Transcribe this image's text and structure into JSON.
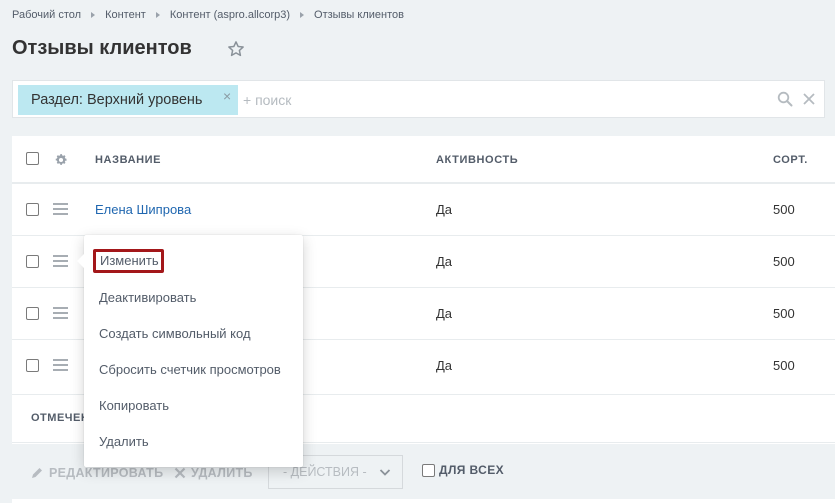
{
  "breadcrumbs": [
    "Рабочий стол",
    "Контент",
    "Контент (aspro.allcorp3)",
    "Отзывы клиентов"
  ],
  "page": {
    "title": "Отзывы клиентов"
  },
  "filter": {
    "chip_label": "Раздел: Верхний уровень",
    "chip_close": "×",
    "search_placeholder": "+ поиск"
  },
  "grid": {
    "columns": {
      "name": "НАЗВАНИЕ",
      "active": "АКТИВНОСТЬ",
      "sort": "СОРТ."
    },
    "rows": [
      {
        "name": "Елена Шипрова",
        "active": "Да",
        "sort": "500"
      },
      {
        "name": "",
        "active": "Да",
        "sort": "500"
      },
      {
        "name": "",
        "active": "Да",
        "sort": "500"
      },
      {
        "name": "",
        "active": "Да",
        "sort": "500"
      }
    ],
    "marked_label": "ОТМЕЧЕН"
  },
  "actions": {
    "edit_label": "РЕДАКТИРОВАТЬ",
    "delete_label": "УДАЛИТЬ",
    "select_label": "- ДЕЙСТВИЯ -",
    "for_all_label": "ДЛЯ ВСЕХ"
  },
  "context_menu": {
    "items": [
      "Изменить",
      "Деактивировать",
      "Создать символьный код",
      "Сбросить счетчик просмотров",
      "Копировать",
      "Удалить"
    ]
  },
  "colors": {
    "accent_link": "#2067b0",
    "chip_bg": "#bce8f1",
    "highlight_border": "#a3171a",
    "page_bg": "#eef2f4"
  }
}
